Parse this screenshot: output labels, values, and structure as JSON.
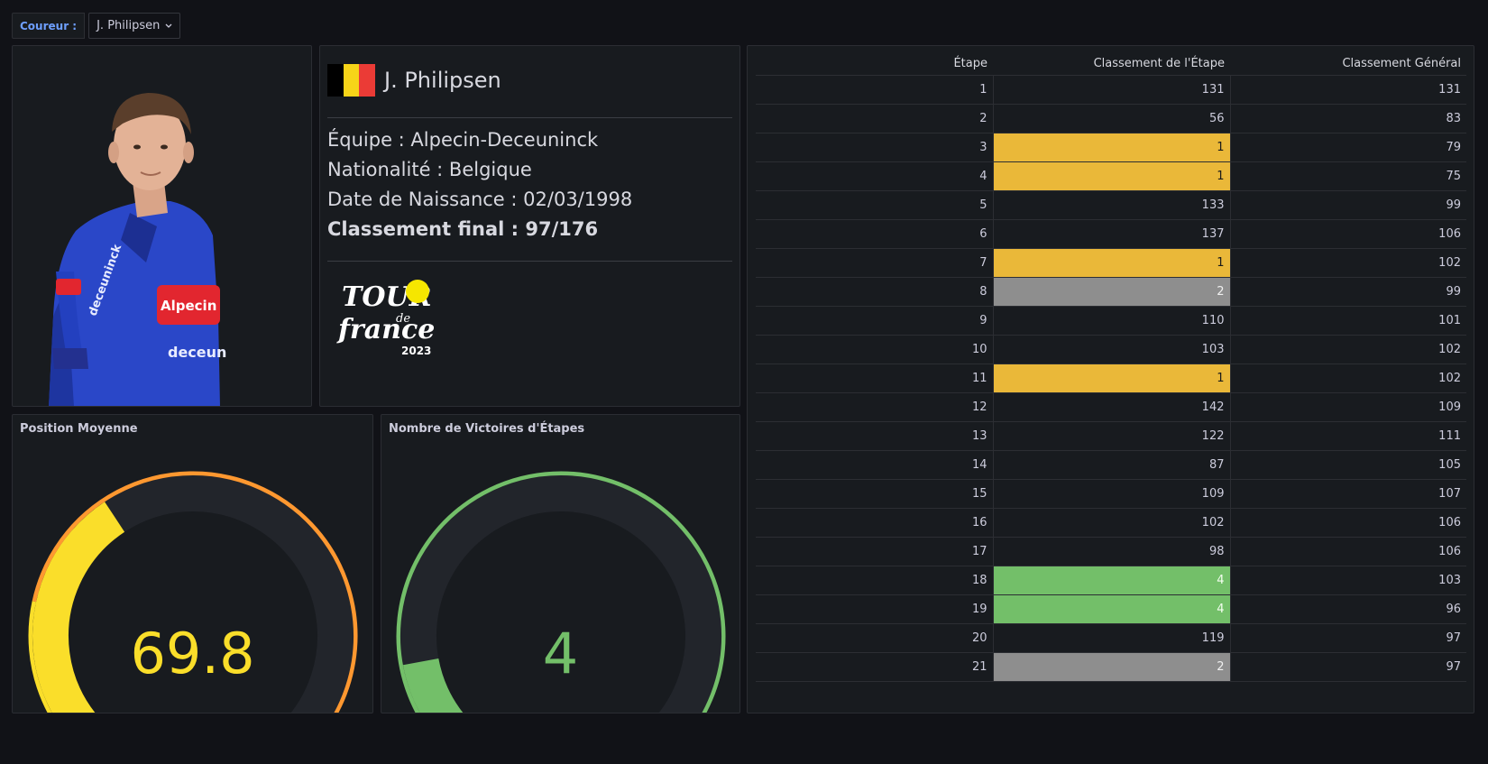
{
  "variables": {
    "label": "Coureur :",
    "value": "J. Philipsen"
  },
  "rider": {
    "name": "J. Philipsen",
    "flag_colors": [
      "#000000",
      "#f7d418",
      "#eb3b36"
    ],
    "team_line": "Équipe : Alpecin-Deceuninck",
    "nationality_line": "Nationalité : Belgique",
    "birth_line": "Date de Naissance : 02/03/1998",
    "final_line": "Classement final : 97/176",
    "photo_jersey_text": "deceuninck",
    "logo_text": "TOUR de france 2023"
  },
  "gauges": {
    "avg_position": {
      "title": "Position Moyenne",
      "value": "69.8",
      "fraction": 0.397,
      "color": "#fade2a",
      "threshold_colors": [
        "#73bf69",
        "#fade2a",
        "#ff9830",
        "#f2495c"
      ]
    },
    "stage_wins": {
      "title": "Nombre de Victoires d'Étapes",
      "value": "4",
      "fraction": 0.19,
      "color": "#73bf69",
      "threshold_colors": [
        "#f2495c",
        "#eab839",
        "#73bf69"
      ]
    }
  },
  "table": {
    "columns": [
      "Étape",
      "Classement de l'Étape",
      "Classement Général"
    ],
    "rows": [
      {
        "stage": "1",
        "stage_rank": "131",
        "gc": "131",
        "hl": ""
      },
      {
        "stage": "2",
        "stage_rank": "56",
        "gc": "83",
        "hl": ""
      },
      {
        "stage": "3",
        "stage_rank": "1",
        "gc": "79",
        "hl": "gold"
      },
      {
        "stage": "4",
        "stage_rank": "1",
        "gc": "75",
        "hl": "gold"
      },
      {
        "stage": "5",
        "stage_rank": "133",
        "gc": "99",
        "hl": ""
      },
      {
        "stage": "6",
        "stage_rank": "137",
        "gc": "106",
        "hl": ""
      },
      {
        "stage": "7",
        "stage_rank": "1",
        "gc": "102",
        "hl": "gold"
      },
      {
        "stage": "8",
        "stage_rank": "2",
        "gc": "99",
        "hl": "silver"
      },
      {
        "stage": "9",
        "stage_rank": "110",
        "gc": "101",
        "hl": ""
      },
      {
        "stage": "10",
        "stage_rank": "103",
        "gc": "102",
        "hl": ""
      },
      {
        "stage": "11",
        "stage_rank": "1",
        "gc": "102",
        "hl": "gold"
      },
      {
        "stage": "12",
        "stage_rank": "142",
        "gc": "109",
        "hl": ""
      },
      {
        "stage": "13",
        "stage_rank": "122",
        "gc": "111",
        "hl": ""
      },
      {
        "stage": "14",
        "stage_rank": "87",
        "gc": "105",
        "hl": ""
      },
      {
        "stage": "15",
        "stage_rank": "109",
        "gc": "107",
        "hl": ""
      },
      {
        "stage": "16",
        "stage_rank": "102",
        "gc": "106",
        "hl": ""
      },
      {
        "stage": "17",
        "stage_rank": "98",
        "gc": "106",
        "hl": ""
      },
      {
        "stage": "18",
        "stage_rank": "4",
        "gc": "103",
        "hl": "green"
      },
      {
        "stage": "19",
        "stage_rank": "4",
        "gc": "96",
        "hl": "green"
      },
      {
        "stage": "20",
        "stage_rank": "119",
        "gc": "97",
        "hl": ""
      },
      {
        "stage": "21",
        "stage_rank": "2",
        "gc": "97",
        "hl": "silver"
      }
    ]
  }
}
